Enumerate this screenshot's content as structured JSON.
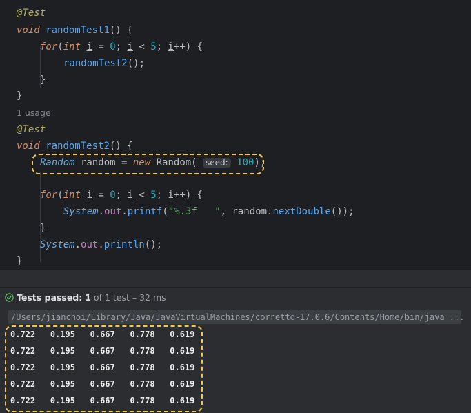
{
  "editor": {
    "method1": {
      "annotation": "@Test",
      "void_kw": "void",
      "name": "randomTest1",
      "signature_tail": "() {",
      "for_kw": "for",
      "for_paren": "(",
      "int_kw": "int",
      "var": "i",
      "assign": " = ",
      "zero": "0",
      "semi1": "; ",
      "lt": " < ",
      "five": "5",
      "semi2": "; ",
      "incr": "++",
      "for_close": ") {",
      "call": "randomTest2",
      "call_tail": "();",
      "close_inner": "}",
      "close_outer": "}"
    },
    "usage_label": "1 usage",
    "method2": {
      "annotation": "@Test",
      "void_kw": "void",
      "name": "randomTest2",
      "signature_tail": "() {",
      "random_type": "Random",
      "random_var": " random = ",
      "new_kw": "new",
      "random_ctor": " Random( ",
      "seed_hint": "seed:",
      "seed_value": "100",
      "ctor_tail": ");",
      "for_kw": "for",
      "for_paren": "(",
      "int_kw": "int",
      "var": "i",
      "assign": " = ",
      "zero": "0",
      "semi1": "; ",
      "lt": " < ",
      "five": "5",
      "semi2": "; ",
      "incr": "++",
      "for_close": ") {",
      "system": "System",
      "dot": ".",
      "out": "out",
      "printf": "printf",
      "open_paren": "(",
      "format_str": "\"%.3f   \"",
      "comma_random": ", random.",
      "next_double": "nextDouble",
      "printf_tail": "());",
      "close_inner": "}",
      "println": "println",
      "println_tail": "();",
      "close_outer": "}"
    }
  },
  "run_panel": {
    "status_label": "Tests passed:",
    "passed_count": "1",
    "status_suffix": "of 1 test – 32 ms",
    "command": "/Users/jianchoi/Library/Java/JavaVirtualMachines/corretto-17.0.6/Contents/Home/bin/java ...",
    "output_rows": [
      [
        "0.722",
        "0.195",
        "0.667",
        "0.778",
        "0.619"
      ],
      [
        "0.722",
        "0.195",
        "0.667",
        "0.778",
        "0.619"
      ],
      [
        "0.722",
        "0.195",
        "0.667",
        "0.778",
        "0.619"
      ],
      [
        "0.722",
        "0.195",
        "0.667",
        "0.778",
        "0.619"
      ],
      [
        "0.722",
        "0.195",
        "0.667",
        "0.778",
        "0.619"
      ]
    ]
  },
  "colors": {
    "editor_bg": "#1e1f22",
    "panel_bg": "#2b2d30",
    "highlight": "#f2c94c",
    "pass_green": "#5fb865"
  },
  "icons": [
    "check-circle-icon"
  ]
}
